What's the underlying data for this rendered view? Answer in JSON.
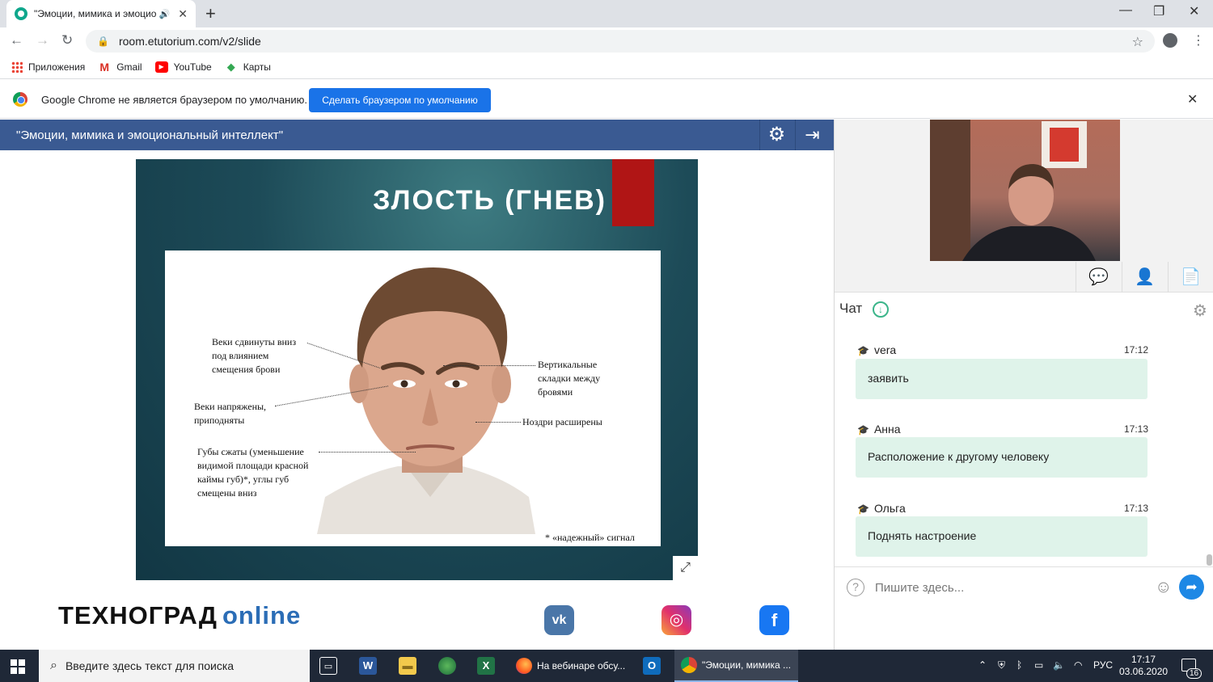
{
  "browser": {
    "tab_title": "\"Эмоции, мимика и эмоцио",
    "url": "room.etutorium.com/v2/slide",
    "bookmarks": [
      "Приложения",
      "Gmail",
      "YouTube",
      "Карты"
    ],
    "infobar_message": "Google Chrome не является браузером по умолчанию.",
    "infobar_button": "Сделать браузером по умолчанию"
  },
  "webinar": {
    "title": "\"Эмоции, мимика и эмоциональный интеллект\""
  },
  "slide": {
    "heading": "ЗЛОСТЬ (ГНЕВ)",
    "annotations": {
      "eyelids_down": "Веки сдвинуты вниз\nпод влиянием\nсмещения брови",
      "eyelids_tense": "Веки напряжены,\nприподняты",
      "lips": "Губы сжаты (уменьшение\nвидимой площади красной\nкаймы губ)*, углы губ\nсмещены вниз",
      "vertical_folds": "Вертикальные\nскладки между\nбровями",
      "nostrils": "Ноздри расширены",
      "footnote": "* «надежный» сигнал"
    }
  },
  "footer": {
    "logo_main": "ТЕХНОГРАД",
    "logo_suffix": "online"
  },
  "chat": {
    "title": "Чат",
    "messages": [
      {
        "author": "vera",
        "time": "17:12",
        "text": "заявить"
      },
      {
        "author": "Анна",
        "time": "17:13",
        "text": "Расположение к другому человеку"
      },
      {
        "author": "Ольга",
        "time": "17:13",
        "text": "Поднять настроение"
      }
    ],
    "input_placeholder": "Пишите здесь..."
  },
  "taskbar": {
    "search_placeholder": "Введите здесь текст для поиска",
    "tasks": [
      "На вебинаре обсу...",
      "\"Эмоции, мимика ..."
    ],
    "language": "РУС",
    "time": "17:17",
    "date": "03.06.2020",
    "notification_count": "16"
  },
  "colors": {
    "webinar_header": "#3a5a92",
    "chat_bubble": "#dff3ea",
    "accent_button": "#1a73e8",
    "slide_red_bar": "#b01515"
  }
}
